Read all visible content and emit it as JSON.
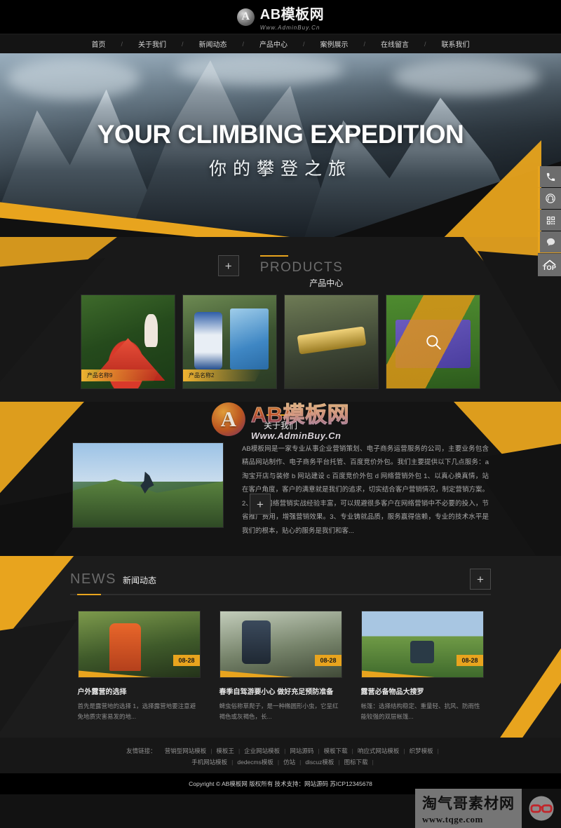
{
  "header": {
    "logo_initial": "A",
    "logo_title": "AB模板网",
    "logo_sub": "Www.AdminBuy.Cn"
  },
  "nav": {
    "items": [
      "首页",
      "关于我们",
      "新闻动态",
      "产品中心",
      "案例展示",
      "在线留言",
      "联系我们"
    ],
    "separator": "/"
  },
  "hero": {
    "title_en": "YOUR CLIMBING EXPEDITION",
    "title_cn": "你的攀登之旅"
  },
  "dock": {
    "items": [
      {
        "name": "phone-icon",
        "label": "电话"
      },
      {
        "name": "headset-icon",
        "label": "在线客服"
      },
      {
        "name": "qrcode-icon",
        "label": "二维码"
      },
      {
        "name": "message-icon",
        "label": "留言"
      }
    ],
    "top_label": "TOP"
  },
  "products": {
    "plus": "+",
    "title_en": "PRODUCTS",
    "title_cn": "产品中心",
    "items": [
      {
        "label": "产品名称9"
      },
      {
        "label": "产品名称2"
      },
      {
        "label": ""
      },
      {
        "label": "",
        "hover": true
      }
    ]
  },
  "watermark": {
    "initial": "A",
    "title": "AB模板网",
    "sub": "Www.AdminBuy.Cn"
  },
  "about": {
    "title_cn": "关于我们",
    "text": "AB模板网是一家专业从事企业营销策划、电子商务运营服务的公司，主要业务包含精品网站制作、电子商务平台托管、百度竞价外包。我们主要提供以下几点服务：a 淘宝开店与装修 b 网站建设 c 百度竞价外包 d 网络营销外包 1、以真心换真情，站在客户角度，客户的满意就是我们的追求，切实结合客户营销情况，制定营销方案。2、团队网络营销实战经验丰富，可以规避很多客户在网络营销中不必要的投入，节省推广费用，增强营销效果。3、专业铸就品质，服务赢得信赖，专业的技术水平是我们的根本，贴心的服务是我们和客...",
    "more": "+"
  },
  "news": {
    "title_en": "NEWS",
    "title_cn": "新闻动态",
    "more": "+",
    "items": [
      {
        "date": "08-28",
        "title": "户外露营的选择",
        "desc": "首先是露营地的选择 1，选择露营地要注意避免地质灾害易发的地..."
      },
      {
        "date": "08-28",
        "title": "春季自驾游要小心 做好充足预防准备",
        "desc": "蜱虫俗称草爬子，是一种椭圆形小虫，它呈红褐色或灰褐色，长..."
      },
      {
        "date": "08-28",
        "title": "露营必备物品大搜罗",
        "desc": "帐篷：选择结构稳定、重量轻、抗风、防雨性能较强的双层帐篷..."
      }
    ]
  },
  "footer": {
    "links_label": "友情链接：",
    "links_row1": [
      "营销型网站模板",
      "模板王",
      "企业网站模板",
      "网站源码",
      "模板下载",
      "响应式网站模板",
      "织梦模板"
    ],
    "links_row2": [
      "手机网站模板",
      "dedecms模板",
      "仿站",
      "discuz模板",
      "图标下载"
    ],
    "separator": "|",
    "copyright": "Copyright © AB模板网 版权所有 技术支持：网站源码 苏ICP12345678"
  },
  "brandbar": {
    "cn": "淘气哥素材网",
    "en": "www.tqge.com",
    "logo": "glasses-icon"
  },
  "colors": {
    "accent": "#e8a41e",
    "bg_dark": "#121212",
    "text_light": "#e8e8e8"
  }
}
